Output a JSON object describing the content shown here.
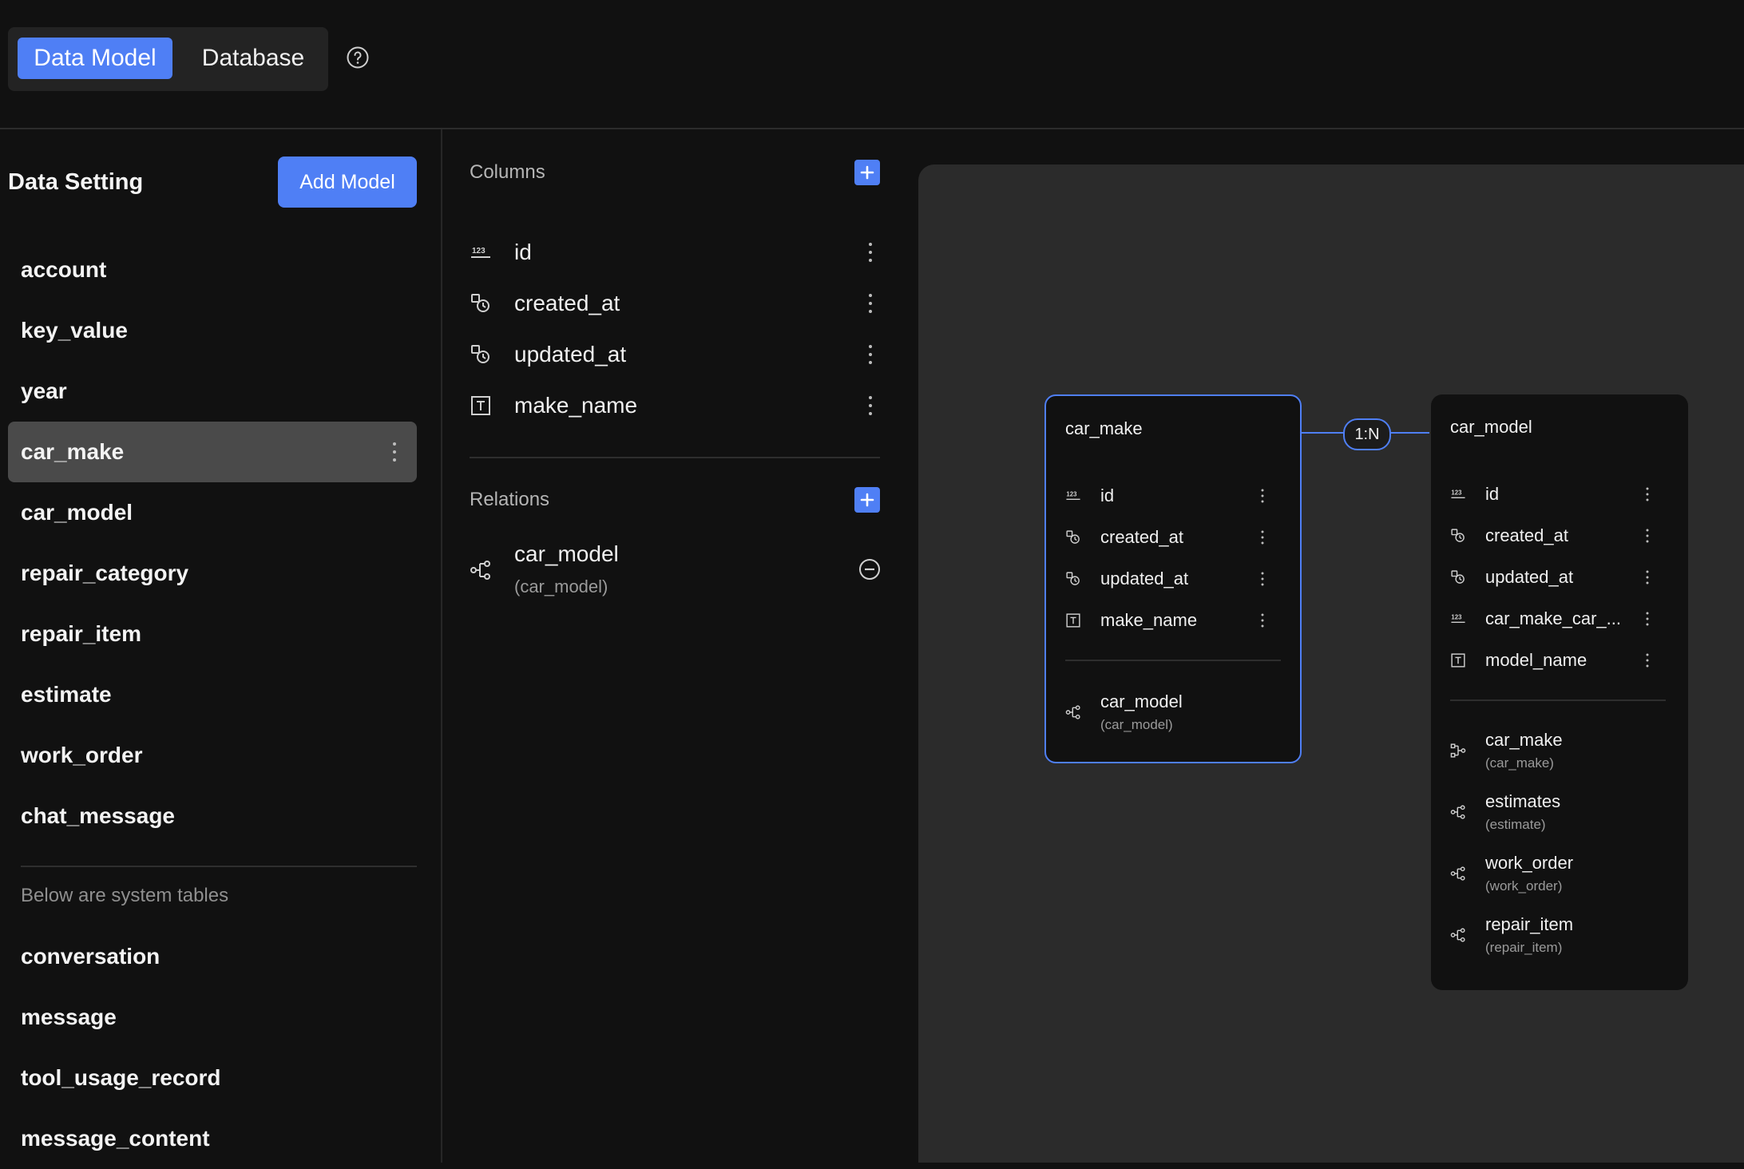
{
  "header": {
    "tabs": [
      {
        "label": "Data Model",
        "active": true
      },
      {
        "label": "Database",
        "active": false
      }
    ],
    "help_icon": "question-circle-icon"
  },
  "sidebar": {
    "title": "Data Setting",
    "add_button_label": "Add Model",
    "models": [
      {
        "label": "account"
      },
      {
        "label": "key_value"
      },
      {
        "label": "year"
      },
      {
        "label": "car_make",
        "selected": true
      },
      {
        "label": "car_model"
      },
      {
        "label": "repair_category"
      },
      {
        "label": "repair_item"
      },
      {
        "label": "estimate"
      },
      {
        "label": "work_order"
      },
      {
        "label": "chat_message"
      }
    ],
    "system_label": "Below are system tables",
    "system_models": [
      {
        "label": "conversation"
      },
      {
        "label": "message"
      },
      {
        "label": "tool_usage_record"
      },
      {
        "label": "message_content"
      }
    ]
  },
  "columns_panel": {
    "columns_title": "Columns",
    "columns": [
      {
        "name": "id",
        "icon": "number-icon"
      },
      {
        "name": "created_at",
        "icon": "datetime-icon"
      },
      {
        "name": "updated_at",
        "icon": "datetime-icon"
      },
      {
        "name": "make_name",
        "icon": "text-icon"
      }
    ],
    "relations_title": "Relations",
    "relations": [
      {
        "name": "car_model",
        "target": "(car_model)",
        "icon": "relation-icon"
      }
    ]
  },
  "erd": {
    "accent": "#4f7ff5",
    "relation_label": "1:N",
    "cards": [
      {
        "title": "car_make",
        "selected": true,
        "columns": [
          {
            "name": "id",
            "icon": "number-icon"
          },
          {
            "name": "created_at",
            "icon": "datetime-icon"
          },
          {
            "name": "updated_at",
            "icon": "datetime-icon"
          },
          {
            "name": "make_name",
            "icon": "text-icon"
          }
        ],
        "relations": [
          {
            "name": "car_model",
            "target": "(car_model)",
            "icon": "relation-icon"
          }
        ]
      },
      {
        "title": "car_model",
        "selected": false,
        "columns": [
          {
            "name": "id",
            "icon": "number-icon"
          },
          {
            "name": "created_at",
            "icon": "datetime-icon"
          },
          {
            "name": "updated_at",
            "icon": "datetime-icon"
          },
          {
            "name": "car_make_car_...",
            "icon": "number-icon"
          },
          {
            "name": "model_name",
            "icon": "text-icon"
          }
        ],
        "relations": [
          {
            "name": "car_make",
            "target": "(car_make)",
            "icon": "parent-relation-icon"
          },
          {
            "name": "estimates",
            "target": "(estimate)",
            "icon": "relation-icon"
          },
          {
            "name": "work_order",
            "target": "(work_order)",
            "icon": "relation-icon"
          },
          {
            "name": "repair_item",
            "target": "(repair_item)",
            "icon": "relation-icon"
          }
        ]
      }
    ]
  }
}
